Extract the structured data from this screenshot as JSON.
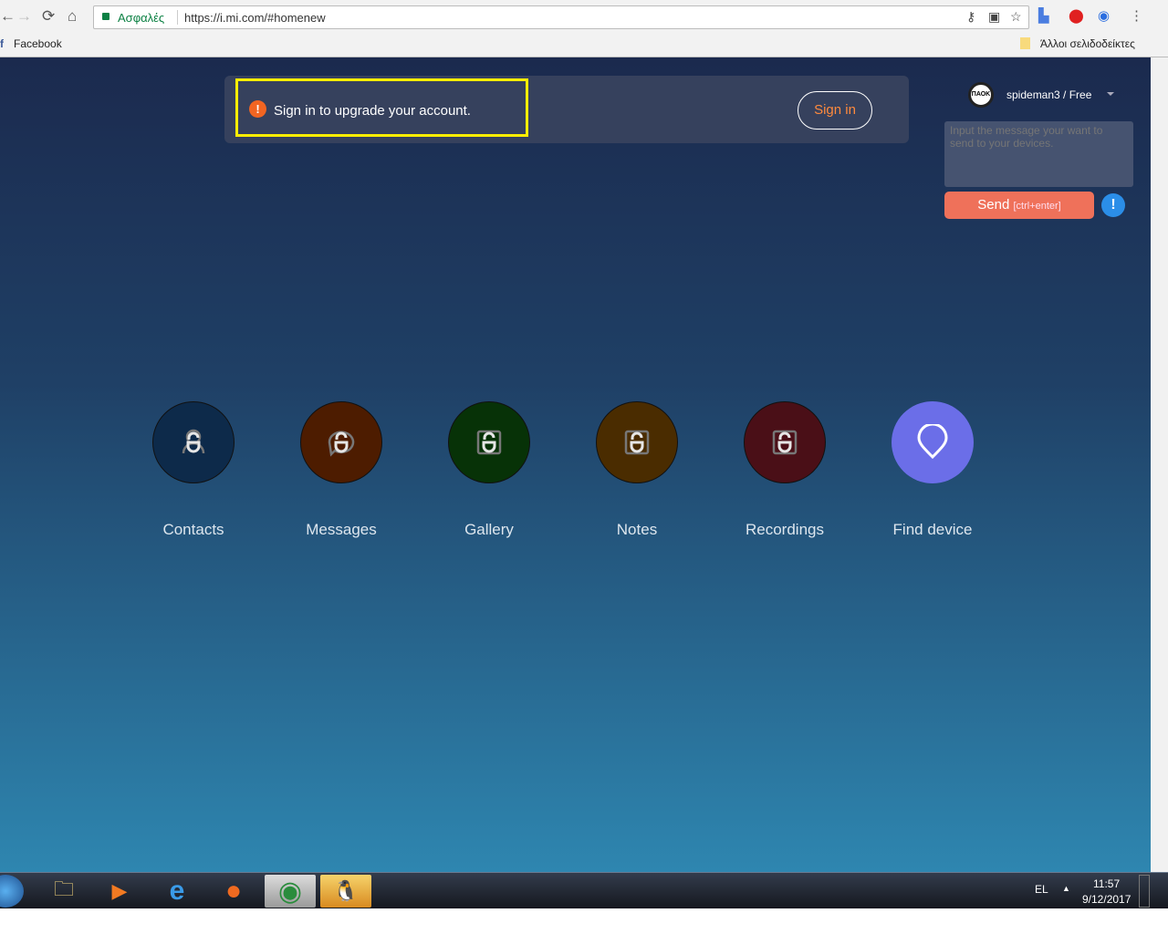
{
  "browser": {
    "secure_label": "Ασφαλές",
    "url": "https://i.mi.com/#homenew",
    "bookmarks": [
      "Facebook"
    ],
    "other_bookmarks": "Άλλοι σελιδοδείκτες"
  },
  "banner": {
    "message": "Sign in to upgrade your account.",
    "signin_label": "Sign in"
  },
  "user": {
    "avatar_text": "ΠΑΟΚ",
    "name": "spideman3 / Free"
  },
  "message_box": {
    "placeholder": "Input the message your want to send to your devices.",
    "send_label": "Send",
    "send_shortcut": "[ctrl+enter]",
    "info": "!"
  },
  "apps": [
    {
      "label": "Contacts",
      "color": "#0d2a4a"
    },
    {
      "label": "Messages",
      "color": "#4d1c00"
    },
    {
      "label": "Gallery",
      "color": "#073207"
    },
    {
      "label": "Notes",
      "color": "#4a2c00"
    },
    {
      "label": "Recordings",
      "color": "#4a0f17"
    },
    {
      "label": "Find device",
      "color": "#6b6ee8"
    }
  ],
  "taskbar": {
    "language": "EL",
    "time": "11:57",
    "date": "9/12/2017"
  }
}
